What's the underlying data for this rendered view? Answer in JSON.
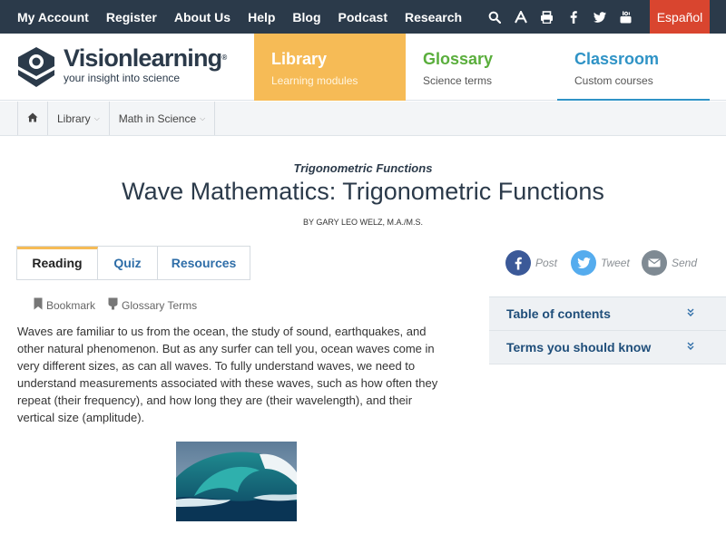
{
  "topnav": {
    "links": [
      "My Account",
      "Register",
      "About Us",
      "Help",
      "Blog",
      "Podcast",
      "Research"
    ],
    "icons": [
      "search-icon",
      "font-size-icon",
      "print-icon",
      "facebook-icon",
      "twitter-icon",
      "youtube-icon"
    ],
    "language_button": "Español"
  },
  "brand": {
    "name": "Visionlearning",
    "trademark": "®",
    "tagline": "your insight into science"
  },
  "mainnav": {
    "library": {
      "title": "Library",
      "subtitle": "Learning modules"
    },
    "glossary": {
      "title": "Glossary",
      "subtitle": "Science terms"
    },
    "classroom": {
      "title": "Classroom",
      "subtitle": "Custom courses"
    }
  },
  "breadcrumb": {
    "items": [
      "Library",
      "Math in Science"
    ]
  },
  "article": {
    "kicker": "Trigonometric Functions",
    "title": "Wave Mathematics: Trigonometric Functions",
    "byline": "BY GARY LEO WELZ, M.A./M.S.",
    "tabs": [
      "Reading",
      "Quiz",
      "Resources"
    ],
    "tools": {
      "bookmark": "Bookmark",
      "glossary_terms": "Glossary Terms"
    },
    "paragraph": "Waves are familiar to us from the ocean, the study of sound, earthquakes, and other natural phenomenon. But as any surfer can tell you, ocean waves come in very different sizes, as can all waves. To fully understand waves, we need to understand measurements associated with these waves, such as how often they repeat (their frequency), and how long they are (their wavelength), and their vertical size (amplitude)."
  },
  "share": {
    "post": "Post",
    "tweet": "Tweet",
    "send": "Send"
  },
  "sidebar": {
    "items": [
      "Table of contents",
      "Terms you should know"
    ]
  },
  "colors": {
    "topbar": "#2b3a4a",
    "espanol": "#d9452f",
    "library": "#f6bb56",
    "glossary": "#5aae3c",
    "classroom": "#2f93c6",
    "facebook": "#3b5998",
    "twitter": "#55acee",
    "email": "#7f8a93"
  }
}
